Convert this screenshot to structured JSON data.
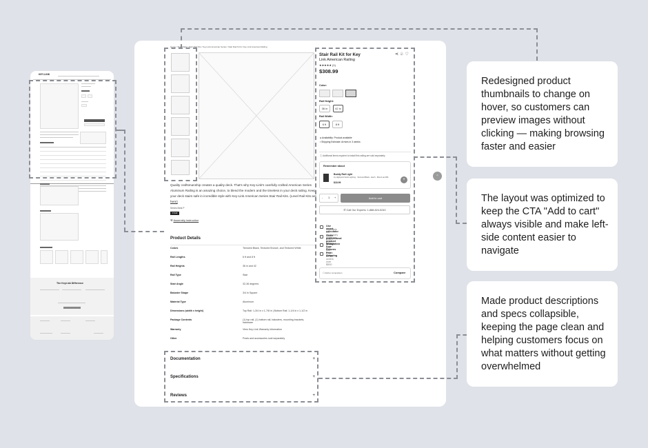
{
  "mobile": {
    "brand": "KEY-LINK",
    "section_compare": "The KeyLink Difference",
    "btn": "Add to cart"
  },
  "breadcrumb": "Home / Stair Rails / Stair Rail Kits / Key-Link American Series / Stair Rail Kit for Key Link American Railing",
  "product": {
    "title": "Stair Rail Kit for Key",
    "subtitle": "Link American Railing",
    "rating": "★★★★★ (1)",
    "price": "$308.99",
    "color_label": "Color:",
    "rail_height_label": "Rail Height:",
    "rail_heights": [
      "36 in",
      "42 in"
    ],
    "rail_width_label": "Rail Width:",
    "rail_widths": [
      "6 ft",
      "8 ft"
    ],
    "availability": "Availability: Product available",
    "shipping": "Shipping Estimate: Arrives in 3 weeks",
    "additional_note": "Additional items required to install this railing are sold separately",
    "remember_title": "Remember about",
    "remember_item_name": "Buddy Rail Light",
    "remember_item_desc": "by Highpoint Deck Lighting - Textured Black - Each - Mount and Bit",
    "remember_item_price": "$18.99",
    "qty_minus": "-",
    "qty_value": "1",
    "qty_plus": "+",
    "add_to_cart": "Add to cart",
    "call_expert": "Call Our Experts: 1-888-824-5240",
    "perks": [
      {
        "a": "Use smart calculator",
        "b": "Calculate the necessary materials"
      },
      {
        "a": "Order professional product installation",
        "b": "Learn more"
      },
      {
        "a": "Worry Free Returns",
        "b": "365 day return policy"
      },
      {
        "a": "Free Shipping",
        "b": "on orders over $500"
      }
    ],
    "compare_add": "Add to comparison",
    "compare": "Compare"
  },
  "description": {
    "line1": "Quality craftsmanship creates a quality deck. That's why Key-Link's carefully crafted American Series",
    "line2": "Aluminum Railing is an amazing choice, to blend the modern and the timeless in your deck railing. Keep",
    "line3": "your deck stairs safe in incredible style with Key-Link American Series Stair Rail Kits. (Level Rail Kits are",
    "line4": "here)",
    "series_label": "Key-Link",
    "series_badge": "Series Best P",
    "badge_dark": "STAIR",
    "assembly": "Assembly instruction"
  },
  "details": {
    "heading": "Product Details",
    "rows": [
      {
        "k": "Colors",
        "v": "Textured Black, Textured Bronze, and Textured White"
      },
      {
        "k": "Rail Lengths",
        "v": "6 ft and 8 ft"
      },
      {
        "k": "Rail Heights",
        "v": "36 in and 42"
      },
      {
        "k": "Rail Type",
        "v": "Stair"
      },
      {
        "k": "Stair Angle",
        "v": "32-36 degrees"
      },
      {
        "k": "Baluster Shape",
        "v": "3/4 in Square"
      },
      {
        "k": "Material Type",
        "v": "Aluminum"
      },
      {
        "k": "Dimensions (width x height)",
        "v": "Top Rail: 1-3/4 in x 1-7/8 in | Bottom Rail: 1-1/4 in x 1-1/2 in"
      },
      {
        "k": "Package Contents",
        "v": "(1) top rail, (1) bottom rail, balusters, mounting brackets, hardware"
      },
      {
        "k": "Warranty",
        "v": "View Key-Link Warranty information"
      },
      {
        "k": "Other",
        "v": "Posts and accessories sold separately"
      }
    ]
  },
  "accordions": [
    "Documentation",
    "Specifications",
    "Reviews"
  ],
  "callouts": [
    "Redesigned product thumbnails to change on hover, so customers can preview images without clicking — making browsing faster and easier",
    "The layout was optimized to keep the CTA \"Add to cart\" always visible and make left-side content easier to navigate",
    "Made product descriptions and specs collapsible, keeping the page clean and helping customers focus on what matters without getting overwhelmed"
  ]
}
